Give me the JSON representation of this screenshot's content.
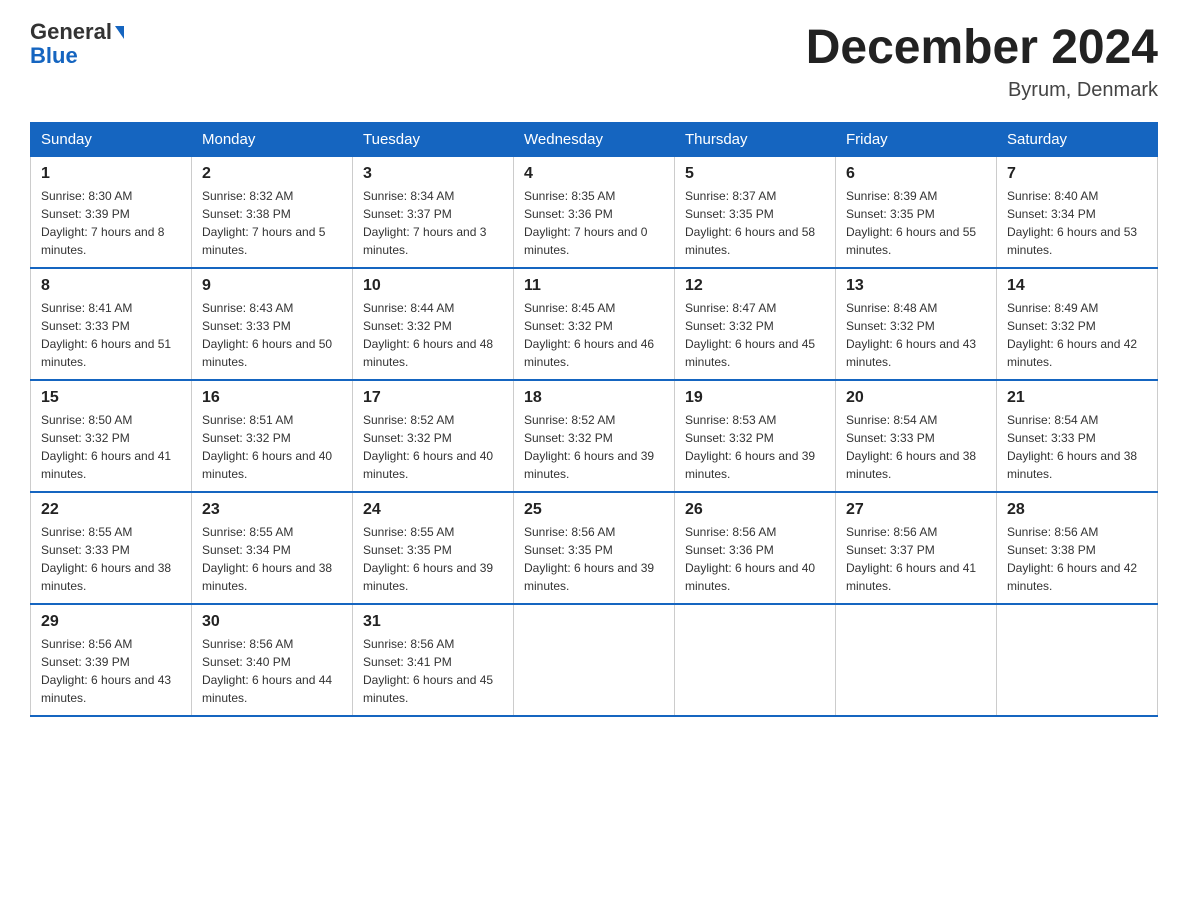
{
  "header": {
    "logo_general": "General",
    "logo_blue": "Blue",
    "month_title": "December 2024",
    "location": "Byrum, Denmark"
  },
  "weekdays": [
    "Sunday",
    "Monday",
    "Tuesday",
    "Wednesday",
    "Thursday",
    "Friday",
    "Saturday"
  ],
  "weeks": [
    [
      {
        "day": "1",
        "sunrise": "8:30 AM",
        "sunset": "3:39 PM",
        "daylight": "7 hours and 8 minutes."
      },
      {
        "day": "2",
        "sunrise": "8:32 AM",
        "sunset": "3:38 PM",
        "daylight": "7 hours and 5 minutes."
      },
      {
        "day": "3",
        "sunrise": "8:34 AM",
        "sunset": "3:37 PM",
        "daylight": "7 hours and 3 minutes."
      },
      {
        "day": "4",
        "sunrise": "8:35 AM",
        "sunset": "3:36 PM",
        "daylight": "7 hours and 0 minutes."
      },
      {
        "day": "5",
        "sunrise": "8:37 AM",
        "sunset": "3:35 PM",
        "daylight": "6 hours and 58 minutes."
      },
      {
        "day": "6",
        "sunrise": "8:39 AM",
        "sunset": "3:35 PM",
        "daylight": "6 hours and 55 minutes."
      },
      {
        "day": "7",
        "sunrise": "8:40 AM",
        "sunset": "3:34 PM",
        "daylight": "6 hours and 53 minutes."
      }
    ],
    [
      {
        "day": "8",
        "sunrise": "8:41 AM",
        "sunset": "3:33 PM",
        "daylight": "6 hours and 51 minutes."
      },
      {
        "day": "9",
        "sunrise": "8:43 AM",
        "sunset": "3:33 PM",
        "daylight": "6 hours and 50 minutes."
      },
      {
        "day": "10",
        "sunrise": "8:44 AM",
        "sunset": "3:32 PM",
        "daylight": "6 hours and 48 minutes."
      },
      {
        "day": "11",
        "sunrise": "8:45 AM",
        "sunset": "3:32 PM",
        "daylight": "6 hours and 46 minutes."
      },
      {
        "day": "12",
        "sunrise": "8:47 AM",
        "sunset": "3:32 PM",
        "daylight": "6 hours and 45 minutes."
      },
      {
        "day": "13",
        "sunrise": "8:48 AM",
        "sunset": "3:32 PM",
        "daylight": "6 hours and 43 minutes."
      },
      {
        "day": "14",
        "sunrise": "8:49 AM",
        "sunset": "3:32 PM",
        "daylight": "6 hours and 42 minutes."
      }
    ],
    [
      {
        "day": "15",
        "sunrise": "8:50 AM",
        "sunset": "3:32 PM",
        "daylight": "6 hours and 41 minutes."
      },
      {
        "day": "16",
        "sunrise": "8:51 AM",
        "sunset": "3:32 PM",
        "daylight": "6 hours and 40 minutes."
      },
      {
        "day": "17",
        "sunrise": "8:52 AM",
        "sunset": "3:32 PM",
        "daylight": "6 hours and 40 minutes."
      },
      {
        "day": "18",
        "sunrise": "8:52 AM",
        "sunset": "3:32 PM",
        "daylight": "6 hours and 39 minutes."
      },
      {
        "day": "19",
        "sunrise": "8:53 AM",
        "sunset": "3:32 PM",
        "daylight": "6 hours and 39 minutes."
      },
      {
        "day": "20",
        "sunrise": "8:54 AM",
        "sunset": "3:33 PM",
        "daylight": "6 hours and 38 minutes."
      },
      {
        "day": "21",
        "sunrise": "8:54 AM",
        "sunset": "3:33 PM",
        "daylight": "6 hours and 38 minutes."
      }
    ],
    [
      {
        "day": "22",
        "sunrise": "8:55 AM",
        "sunset": "3:33 PM",
        "daylight": "6 hours and 38 minutes."
      },
      {
        "day": "23",
        "sunrise": "8:55 AM",
        "sunset": "3:34 PM",
        "daylight": "6 hours and 38 minutes."
      },
      {
        "day": "24",
        "sunrise": "8:55 AM",
        "sunset": "3:35 PM",
        "daylight": "6 hours and 39 minutes."
      },
      {
        "day": "25",
        "sunrise": "8:56 AM",
        "sunset": "3:35 PM",
        "daylight": "6 hours and 39 minutes."
      },
      {
        "day": "26",
        "sunrise": "8:56 AM",
        "sunset": "3:36 PM",
        "daylight": "6 hours and 40 minutes."
      },
      {
        "day": "27",
        "sunrise": "8:56 AM",
        "sunset": "3:37 PM",
        "daylight": "6 hours and 41 minutes."
      },
      {
        "day": "28",
        "sunrise": "8:56 AM",
        "sunset": "3:38 PM",
        "daylight": "6 hours and 42 minutes."
      }
    ],
    [
      {
        "day": "29",
        "sunrise": "8:56 AM",
        "sunset": "3:39 PM",
        "daylight": "6 hours and 43 minutes."
      },
      {
        "day": "30",
        "sunrise": "8:56 AM",
        "sunset": "3:40 PM",
        "daylight": "6 hours and 44 minutes."
      },
      {
        "day": "31",
        "sunrise": "8:56 AM",
        "sunset": "3:41 PM",
        "daylight": "6 hours and 45 minutes."
      },
      null,
      null,
      null,
      null
    ]
  ],
  "labels": {
    "sunrise": "Sunrise:",
    "sunset": "Sunset:",
    "daylight": "Daylight:"
  }
}
